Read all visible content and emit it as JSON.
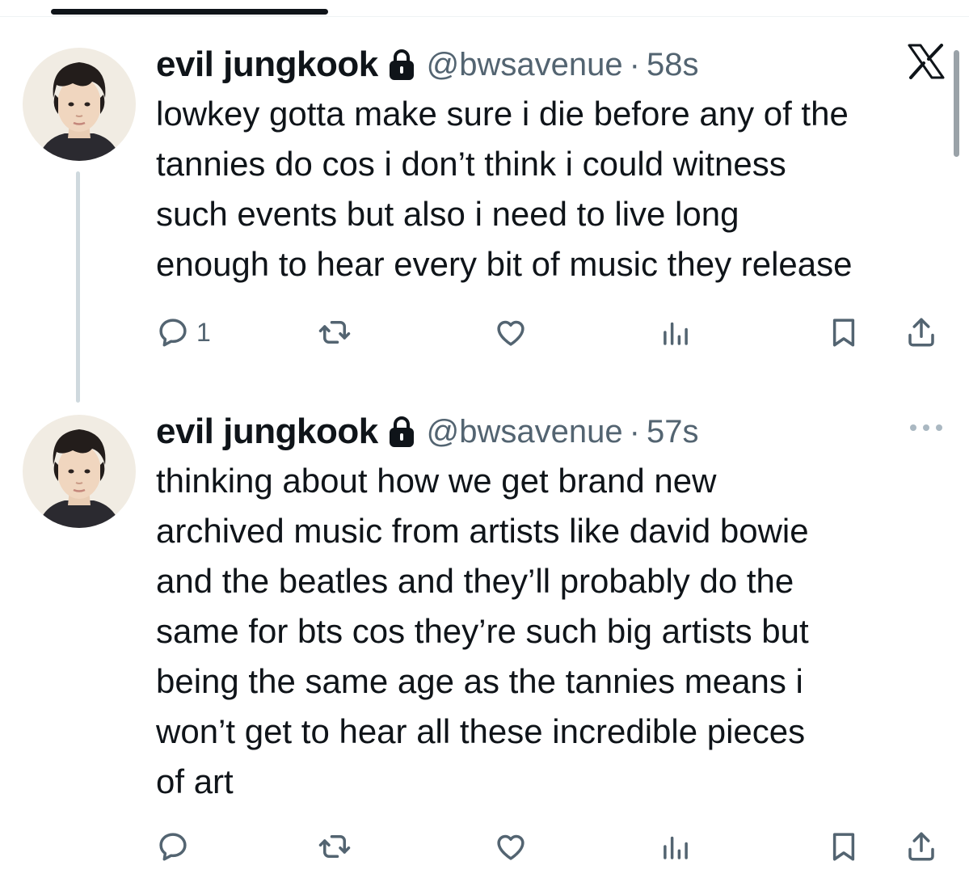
{
  "tweets": [
    {
      "name": "evil jungkook",
      "handle": "@bwsavenue",
      "separator": "·",
      "time": "58s",
      "lines": [
        "lowkey gotta make sure i die before any of the",
        "tannies do cos i don’t think i could witness",
        "such events but also i need to live long",
        "enough to hear every bit of music they release"
      ],
      "reply_count": "1",
      "corner_icon": "x-logo-icon"
    },
    {
      "name": "evil jungkook",
      "handle": "@bwsavenue",
      "separator": "·",
      "time": "57s",
      "lines": [
        "thinking about how we get brand new",
        "archived music from artists like david bowie",
        "and the beatles and they’ll probably do the",
        "same for bts cos they’re such big artists but",
        "being the same age as the tannies means i",
        "won’t get to hear all these incredible pieces",
        "of art"
      ],
      "reply_count": "",
      "corner_icon": "more-options-icon"
    }
  ],
  "icons": [
    "lock-icon",
    "reply-icon",
    "retweet-icon",
    "like-icon",
    "views-icon",
    "bookmark-icon",
    "share-icon"
  ],
  "colors": {
    "text": "#0f1419",
    "secondary": "#536471",
    "thread_line": "#cfd9de",
    "background": "#ffffff"
  }
}
